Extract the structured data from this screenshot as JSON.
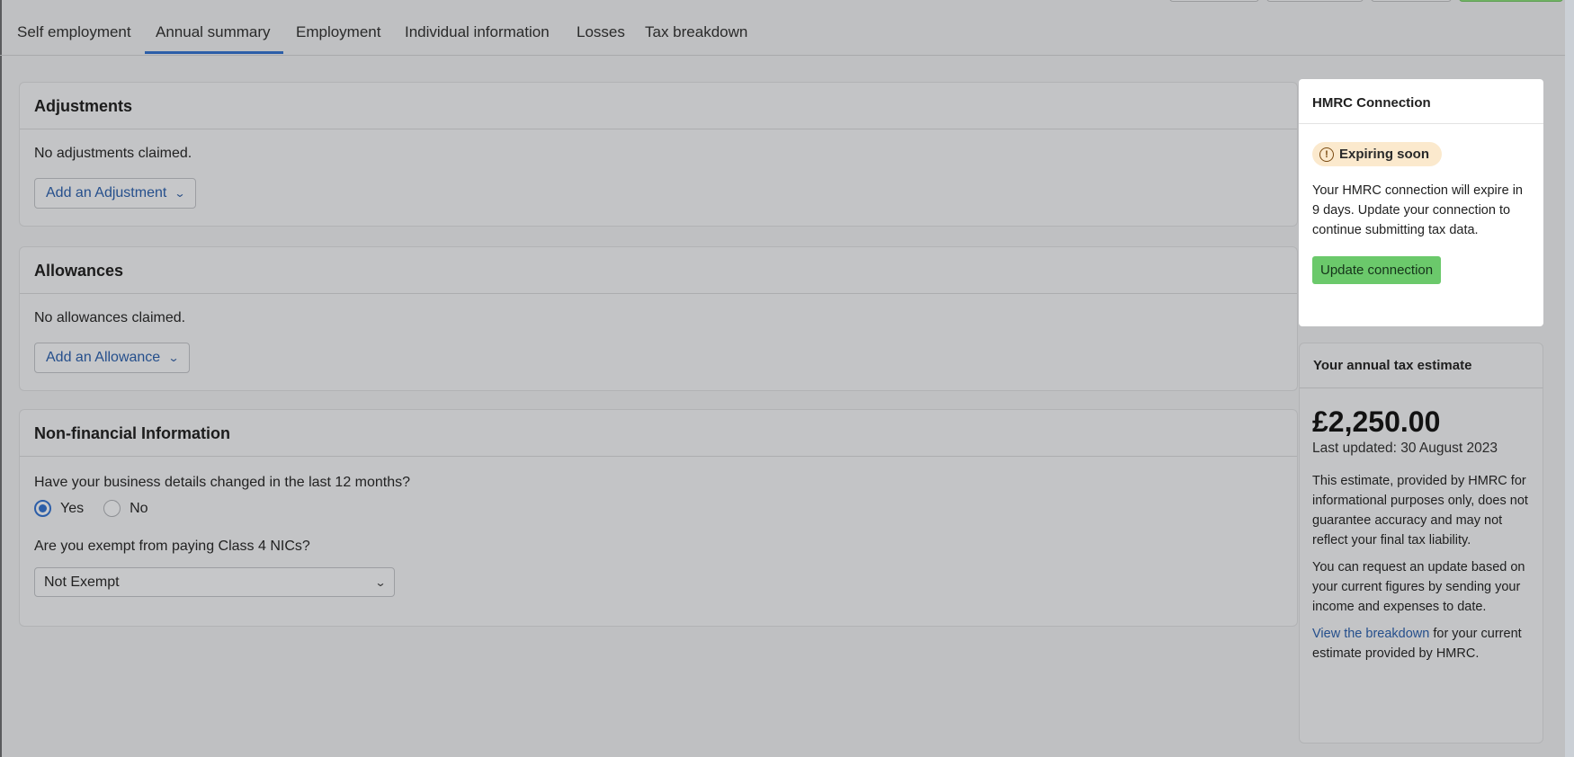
{
  "tabs": [
    {
      "label": "Self employment",
      "active": false
    },
    {
      "label": "Annual summary",
      "active": true
    },
    {
      "label": "Employment",
      "active": false
    },
    {
      "label": "Individual information",
      "active": false
    },
    {
      "label": "Losses",
      "active": false
    },
    {
      "label": "Tax breakdown",
      "active": false
    }
  ],
  "adjustments": {
    "title": "Adjustments",
    "empty_text": "No adjustments claimed.",
    "add_button": "Add an Adjustment"
  },
  "allowances": {
    "title": "Allowances",
    "empty_text": "No allowances claimed.",
    "add_button": "Add an Allowance"
  },
  "non_financial": {
    "title": "Non-financial Information",
    "question_changed": "Have your business details changed in the last 12 months?",
    "options": [
      {
        "label": "Yes",
        "selected": true
      },
      {
        "label": "No",
        "selected": false
      }
    ],
    "question_exempt": "Are you exempt from paying Class 4 NICs?",
    "exempt_value": "Not Exempt"
  },
  "hmrc_connection": {
    "title": "HMRC Connection",
    "badge": "Expiring soon",
    "badge_icon": "warning-circle-icon",
    "message": "Your HMRC connection will expire in 9 days. Update your connection to continue submitting tax data.",
    "button": "Update connection"
  },
  "tax_estimate": {
    "title": "Your annual tax estimate",
    "amount": "£2,250.00",
    "last_updated": "Last updated: 30 August 2023",
    "disclaimer": "This estimate, provided by HMRC for informational purposes only, does not guarantee accuracy and may not reflect your final tax liability.",
    "request_text": "You can request an update based on your current figures by sending your income and expenses to date.",
    "link_text": "View the breakdown",
    "link_suffix": " for your current estimate provided by HMRC."
  },
  "colors": {
    "accent": "#2c5ea8",
    "success": "#6bc96b",
    "warning_bg": "#fbe9cd"
  }
}
